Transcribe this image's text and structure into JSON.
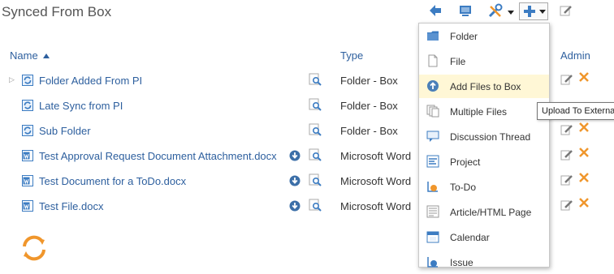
{
  "page": {
    "title": "Synced From Box"
  },
  "columns": {
    "name": "Name",
    "type": "Type",
    "admin": "Admin"
  },
  "rows": [
    {
      "name": "Folder Added From PI",
      "type": "Folder - Box",
      "icon": "sync-folder-icon"
    },
    {
      "name": "Late Sync from PI",
      "type": "Folder - Box",
      "icon": "sync-folder-icon"
    },
    {
      "name": "Sub Folder",
      "type": "Folder - Box",
      "icon": "sync-folder-icon"
    },
    {
      "name": "Test Approval Request Document Attachment.docx",
      "type": "Microsoft Word",
      "icon": "word-doc-icon"
    },
    {
      "name": "Test Document for a ToDo.docx",
      "type": "Microsoft Word",
      "icon": "word-doc-icon"
    },
    {
      "name": "Test File.docx",
      "type": "Microsoft Word",
      "icon": "word-doc-icon"
    }
  ],
  "menu": {
    "items": [
      {
        "label": "Folder",
        "icon": "folder-icon"
      },
      {
        "label": "File",
        "icon": "file-icon"
      },
      {
        "label": "Add Files to Box",
        "icon": "upload-icon",
        "highlighted": true
      },
      {
        "label": "Multiple Files",
        "icon": "multiple-files-icon"
      },
      {
        "label": "Discussion Thread",
        "icon": "discussion-icon"
      },
      {
        "label": "Project",
        "icon": "project-icon"
      },
      {
        "label": "To-Do",
        "icon": "todo-icon"
      },
      {
        "label": "Article/HTML Page",
        "icon": "article-icon"
      },
      {
        "label": "Calendar",
        "icon": "calendar-icon"
      },
      {
        "label": "Issue",
        "icon": "issue-icon"
      }
    ]
  },
  "tooltip": {
    "text": "Upload To External"
  },
  "colors": {
    "link": "#2d5f9e",
    "accent_blue": "#3c7cc2",
    "orange": "#f0962c",
    "highlight": "#fff7d6"
  }
}
